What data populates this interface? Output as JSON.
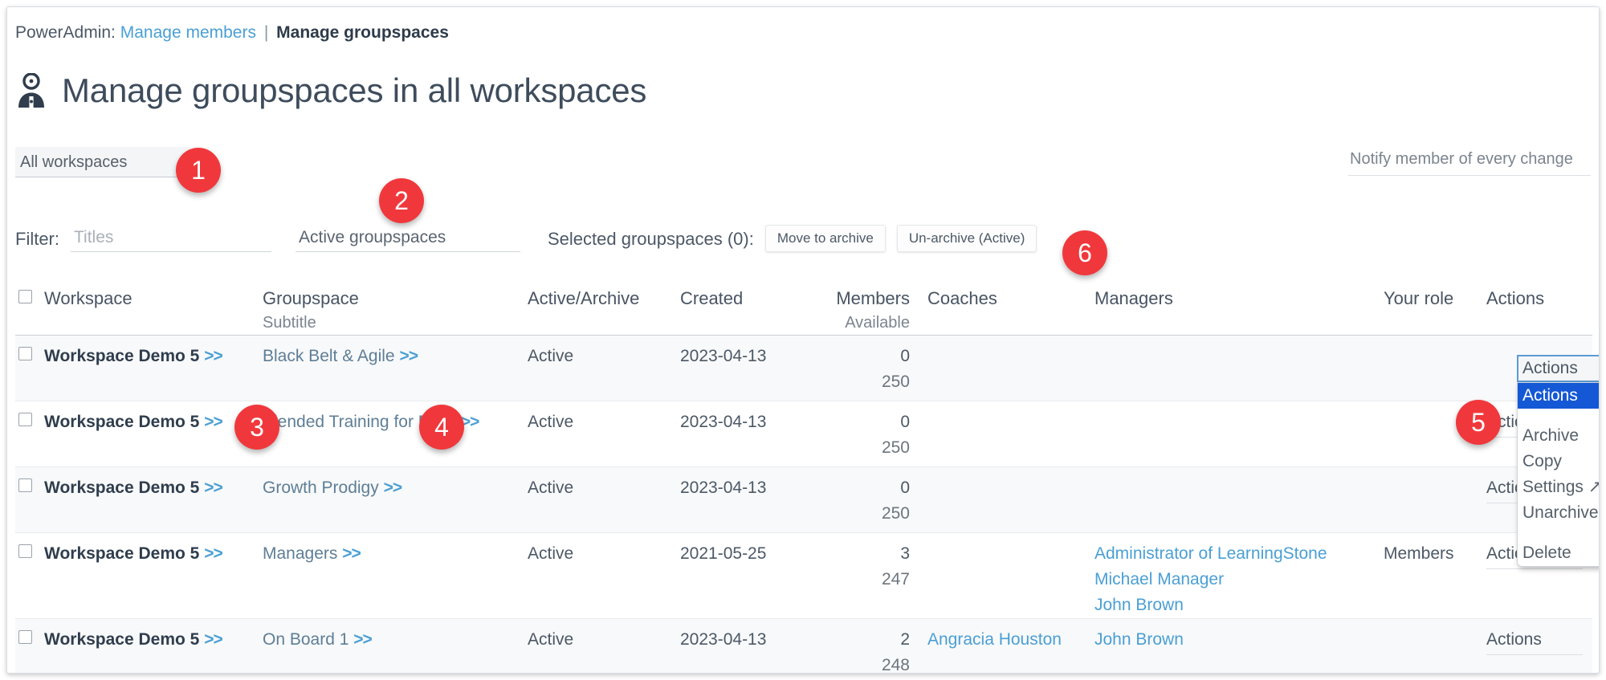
{
  "breadcrumb": {
    "prefix": "PowerAdmin:",
    "link": "Manage members",
    "separator": "|",
    "current": "Manage groupspaces"
  },
  "header": {
    "title": "Manage groupspaces in all workspaces",
    "icon": "user-admin-icon"
  },
  "toolbar": {
    "workspace_select_value": "All workspaces",
    "notify_label": "Notify member of every change",
    "filter_label": "Filter:",
    "titles_placeholder": "Titles",
    "titles_value": "",
    "active_select_value": "Active groupspaces",
    "selected_label": "Selected groupspaces (0):",
    "move_to_archive_label": "Move to archive",
    "unarchive_active_label": "Un-archive (Active)"
  },
  "table": {
    "headers": {
      "workspace": "Workspace",
      "groupspace": "Groupspace",
      "groupspace_sub": "Subtitle",
      "state": "Active/Archive",
      "created": "Created",
      "members": "Members",
      "members_sub": "Available",
      "coaches": "Coaches",
      "managers": "Managers",
      "role": "Your role",
      "actions": "Actions"
    },
    "rows": [
      {
        "workspace": "Workspace Demo 5",
        "chevron": ">>",
        "groupspace": "Black Belt & Agile",
        "state": "Active",
        "created": "2023-04-13",
        "members": "0",
        "available": "250",
        "coaches": [],
        "managers": [],
        "role": "",
        "actions": "Actions"
      },
      {
        "workspace": "Workspace Demo 5",
        "chevron": ">>",
        "groupspace": "Blended Training for Pro's",
        "state": "Active",
        "created": "2023-04-13",
        "members": "0",
        "available": "250",
        "coaches": [],
        "managers": [],
        "role": "",
        "actions": "Actions"
      },
      {
        "workspace": "Workspace Demo 5",
        "chevron": ">>",
        "groupspace": "Growth Prodigy",
        "state": "Active",
        "created": "2023-04-13",
        "members": "0",
        "available": "250",
        "coaches": [],
        "managers": [],
        "role": "",
        "actions": "Actions"
      },
      {
        "workspace": "Workspace Demo 5",
        "chevron": ">>",
        "groupspace": "Managers",
        "state": "Active",
        "created": "2021-05-25",
        "members": "3",
        "available": "247",
        "coaches": [],
        "managers": [
          "Administrator of LearningStone",
          "Michael Manager",
          "John Brown"
        ],
        "role": "Members",
        "actions": "Actions"
      },
      {
        "workspace": "Workspace Demo 5",
        "chevron": ">>",
        "groupspace": "On Board 1",
        "state": "Active",
        "created": "2023-04-13",
        "members": "2",
        "available": "248",
        "coaches": [
          "Angracia Houston"
        ],
        "managers": [
          "John Brown"
        ],
        "role": "",
        "actions": "Actions"
      }
    ]
  },
  "actions_dropdown": {
    "closed_value": "Actions",
    "options": [
      {
        "label": "Actions",
        "selected": true
      },
      {
        "label": "",
        "gap": true
      },
      {
        "label": "Archive",
        "selected": false
      },
      {
        "label": "Copy",
        "selected": false
      },
      {
        "label": "Settings ↗",
        "selected": false
      },
      {
        "label": "Unarchive",
        "selected": false
      },
      {
        "label": "",
        "gap": true
      },
      {
        "label": "Delete",
        "selected": false
      }
    ]
  },
  "markers": [
    {
      "n": "1"
    },
    {
      "n": "2"
    },
    {
      "n": "3"
    },
    {
      "n": "4"
    },
    {
      "n": "5"
    },
    {
      "n": "6"
    }
  ],
  "colors": {
    "marker_red": "#f0383c",
    "link_blue": "#4a9fd4",
    "select_highlight": "#1558d6",
    "focus_border": "#5b9bd5"
  }
}
